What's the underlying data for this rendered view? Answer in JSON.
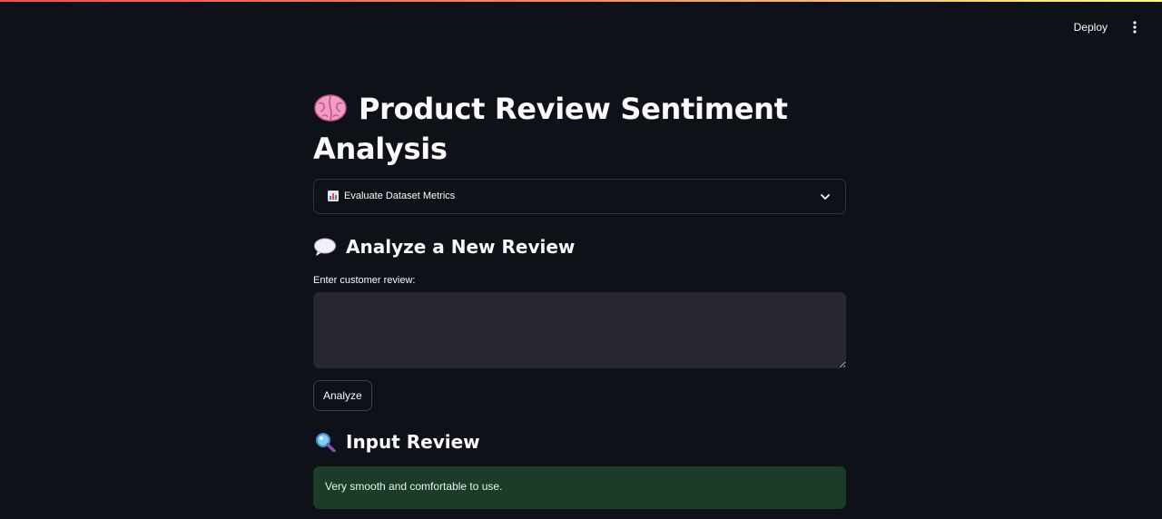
{
  "header": {
    "deploy_label": "Deploy",
    "menu_icon": "more-vertical-icon"
  },
  "accent_colors": {
    "stripe_start": "#ff4b4b",
    "stripe_end": "#fffd80",
    "background": "#0e1117",
    "input_bg": "#262730",
    "success_bg": "#1a3c28"
  },
  "main": {
    "title": "Product Review Sentiment Analysis",
    "title_icon": "brain-icon",
    "expander": {
      "label": "Evaluate Dataset Metrics",
      "icon": "bar-chart-icon",
      "expanded": false
    },
    "analyze_section": {
      "heading": "Analyze a New Review",
      "icon": "speech-bubble-icon",
      "input_label": "Enter customer review:",
      "input_value": "",
      "input_placeholder": "",
      "button_label": "Analyze"
    },
    "input_review_section": {
      "heading": "Input Review",
      "icon": "magnifier-icon",
      "review_text": "Very smooth and comfortable to use."
    }
  }
}
